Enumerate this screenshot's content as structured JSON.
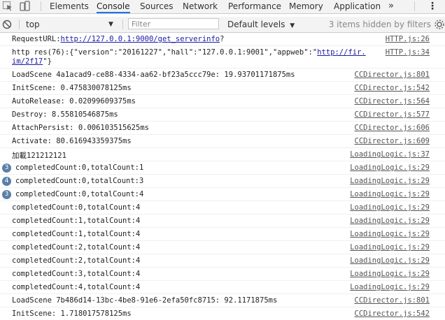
{
  "tabs": {
    "elements": "Elements",
    "console": "Console",
    "sources": "Sources",
    "network": "Network",
    "performance": "Performance",
    "memory": "Memory",
    "application": "Application",
    "more": "»",
    "menu": "⋮"
  },
  "toolbar": {
    "context": "top",
    "context_arrow": "▼",
    "filter_placeholder": "Filter",
    "levels": "Default levels",
    "levels_arrow": "▼",
    "hidden_note": "3 items hidden by filters"
  },
  "console": {
    "rows": [
      {
        "text_before": "RequestURL:",
        "link": "http://127.0.0.1:9000/get_serverinfo",
        "text_after": "?",
        "src": "HTTP.js:26"
      },
      {
        "text_before": "http res(76):{\"version\":\"20161227\",\"hall\":\"127.0.0.1:9001\",\"appweb\":\"",
        "link": "http://fir.im/2f17",
        "text_after": "\"}",
        "src": "HTTP.js:34"
      },
      {
        "text": "LoadScene 4a1acad9-ce88-4334-aa62-bf23a5ccc79e: 19.93701171875ms",
        "src": "CCDirector.js:801"
      },
      {
        "text": "InitScene: 0.475830078125ms",
        "src": "CCDirector.js:542"
      },
      {
        "text": "AutoRelease: 0.02099609375ms",
        "src": "CCDirector.js:564"
      },
      {
        "text": "Destroy: 8.55810546875ms",
        "src": "CCDirector.js:577"
      },
      {
        "text": "AttachPersist: 0.006103515625ms",
        "src": "CCDirector.js:606"
      },
      {
        "text": "Activate: 80.616943359375ms",
        "src": "CCDirector.js:609"
      },
      {
        "text": "加載121212121",
        "src": "LoadingLogic.js:37"
      },
      {
        "count": "3",
        "text": "completedCount:0,totalCount:1",
        "src": "LoadingLogic.js:29"
      },
      {
        "count": "4",
        "text": "completedCount:0,totalCount:3",
        "src": "LoadingLogic.js:29"
      },
      {
        "count": "3",
        "text": "completedCount:0,totalCount:4",
        "src": "LoadingLogic.js:29"
      },
      {
        "text": "completedCount:0,totalCount:4",
        "src": "LoadingLogic.js:29"
      },
      {
        "text": "completedCount:1,totalCount:4",
        "src": "LoadingLogic.js:29"
      },
      {
        "text": "completedCount:1,totalCount:4",
        "src": "LoadingLogic.js:29"
      },
      {
        "text": "completedCount:2,totalCount:4",
        "src": "LoadingLogic.js:29"
      },
      {
        "text": "completedCount:2,totalCount:4",
        "src": "LoadingLogic.js:29"
      },
      {
        "text": "completedCount:3,totalCount:4",
        "src": "LoadingLogic.js:29"
      },
      {
        "text": "completedCount:4,totalCount:4",
        "src": "LoadingLogic.js:29"
      },
      {
        "text": "LoadScene 7b486d14-13bc-4be8-91e6-2efa50fc8715: 92.1171875ms",
        "src": "CCDirector.js:801"
      },
      {
        "text": "InitScene: 1.718017578125ms",
        "src": "CCDirector.js:542"
      }
    ]
  },
  "colors": {
    "accent": "#1a73e8",
    "badge": "#5a7fa8",
    "link": "#1a1aa6"
  }
}
